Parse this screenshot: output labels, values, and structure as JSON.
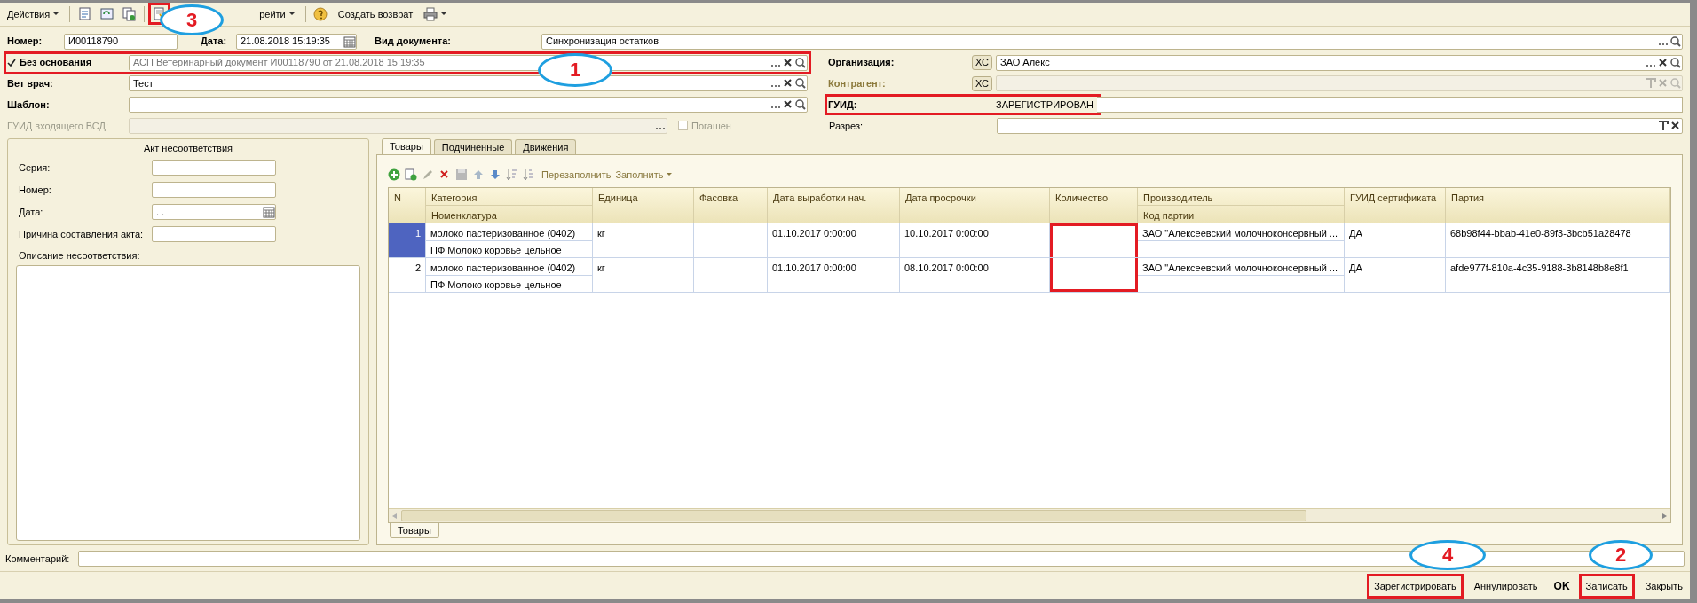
{
  "toolbar": {
    "actions_menu": "Действия",
    "goto_menu": "рейти",
    "create_return": "Создать возврат"
  },
  "fields": {
    "number": {
      "label": "Номер:",
      "value": "И00118790"
    },
    "date": {
      "label": "Дата:",
      "value": "21.08.2018 15:19:35"
    },
    "doc_type": {
      "label": "Вид документа:",
      "value": "Синхронизация остатков"
    },
    "no_basis": {
      "label": "Без основания",
      "checked": true,
      "value": "АСП Ветеринарный документ И00118790 от 21.08.2018 15:19:35"
    },
    "organization": {
      "label": "Организация:",
      "button": "ХС",
      "value": "ЗАО  Алекс"
    },
    "vet": {
      "label": "Вет врач:",
      "value": "Тест"
    },
    "counterparty": {
      "label": "Контрагент:",
      "button": "ХС",
      "disabled": true
    },
    "template": {
      "label": "Шаблон:"
    },
    "guid": {
      "label": "ГУИД:",
      "value": "ЗАРЕГИСТРИРОВАН"
    },
    "incoming_guid": {
      "label": "ГУИД входящего ВСД:",
      "disabled": true
    },
    "repaid": {
      "label": "Погашен",
      "checked": false,
      "disabled": true
    },
    "section": {
      "label": "Разрез:"
    }
  },
  "act": {
    "title": "Акт несоответствия",
    "fields": [
      {
        "label": "Серия:"
      },
      {
        "label": "Номер:"
      },
      {
        "label": "Дата:",
        "value": ". ."
      },
      {
        "label": "Причина составления акта:"
      }
    ],
    "description_label": "Описание несоответствия:"
  },
  "tabs": [
    {
      "label": "Товары",
      "selected": true
    },
    {
      "label": "Подчиненные",
      "selected": false
    },
    {
      "label": "Движения",
      "selected": false
    }
  ],
  "table_toolbar": {
    "refill": "Перезаполнить",
    "fill": "Заполнить"
  },
  "table": {
    "columns": [
      {
        "label": "N"
      },
      {
        "label": "Категория",
        "sub": "Номенклатура"
      },
      {
        "label": "Единица"
      },
      {
        "label": "Фасовка"
      },
      {
        "label": "Дата выработки нач."
      },
      {
        "label": "Дата просрочки"
      },
      {
        "label": "Количество"
      },
      {
        "label": "Производитель",
        "sub": "Код партии"
      },
      {
        "label": "ГУИД сертификата"
      },
      {
        "label": "Партия"
      }
    ],
    "rows": [
      {
        "selected": true,
        "n": "1",
        "category": "молоко пастеризованное (0402)",
        "nomenclature": "ПФ Молоко коровье цельное",
        "unit": "кг",
        "prod_date": "01.10.2017 0:00:00",
        "exp_date": "10.10.2017 0:00:00",
        "producer": "ЗАО \"Алексеевский молочноконсервный ...",
        "cert_guid": "ДА",
        "batch": "68b98f44-bbab-41e0-89f3-3bcb51a28478"
      },
      {
        "selected": false,
        "n": "2",
        "category": "молоко пастеризованное (0402)",
        "nomenclature": "ПФ Молоко коровье цельное",
        "unit": "кг",
        "prod_date": "01.10.2017 0:00:00",
        "exp_date": "08.10.2017 0:00:00",
        "producer": "ЗАО \"Алексеевский молочноконсервный ...",
        "cert_guid": "ДА",
        "batch": "afde977f-810a-4c35-9188-3b8148b8e8f1"
      }
    ]
  },
  "bottom_tabs": [
    {
      "label": "Товары",
      "selected": true
    }
  ],
  "comment": {
    "label": "Комментарий:"
  },
  "buttons": [
    {
      "label": "Зарегистрировать",
      "kind": "plain"
    },
    {
      "label": "Аннулировать",
      "kind": "plain"
    },
    {
      "label": "OK",
      "kind": "default"
    },
    {
      "label": "Записать",
      "kind": "plain"
    },
    {
      "label": "Закрыть",
      "kind": "plain"
    }
  ],
  "annotations": [
    {
      "label": "1"
    },
    {
      "label": "2"
    },
    {
      "label": "3"
    },
    {
      "label": "4"
    }
  ]
}
